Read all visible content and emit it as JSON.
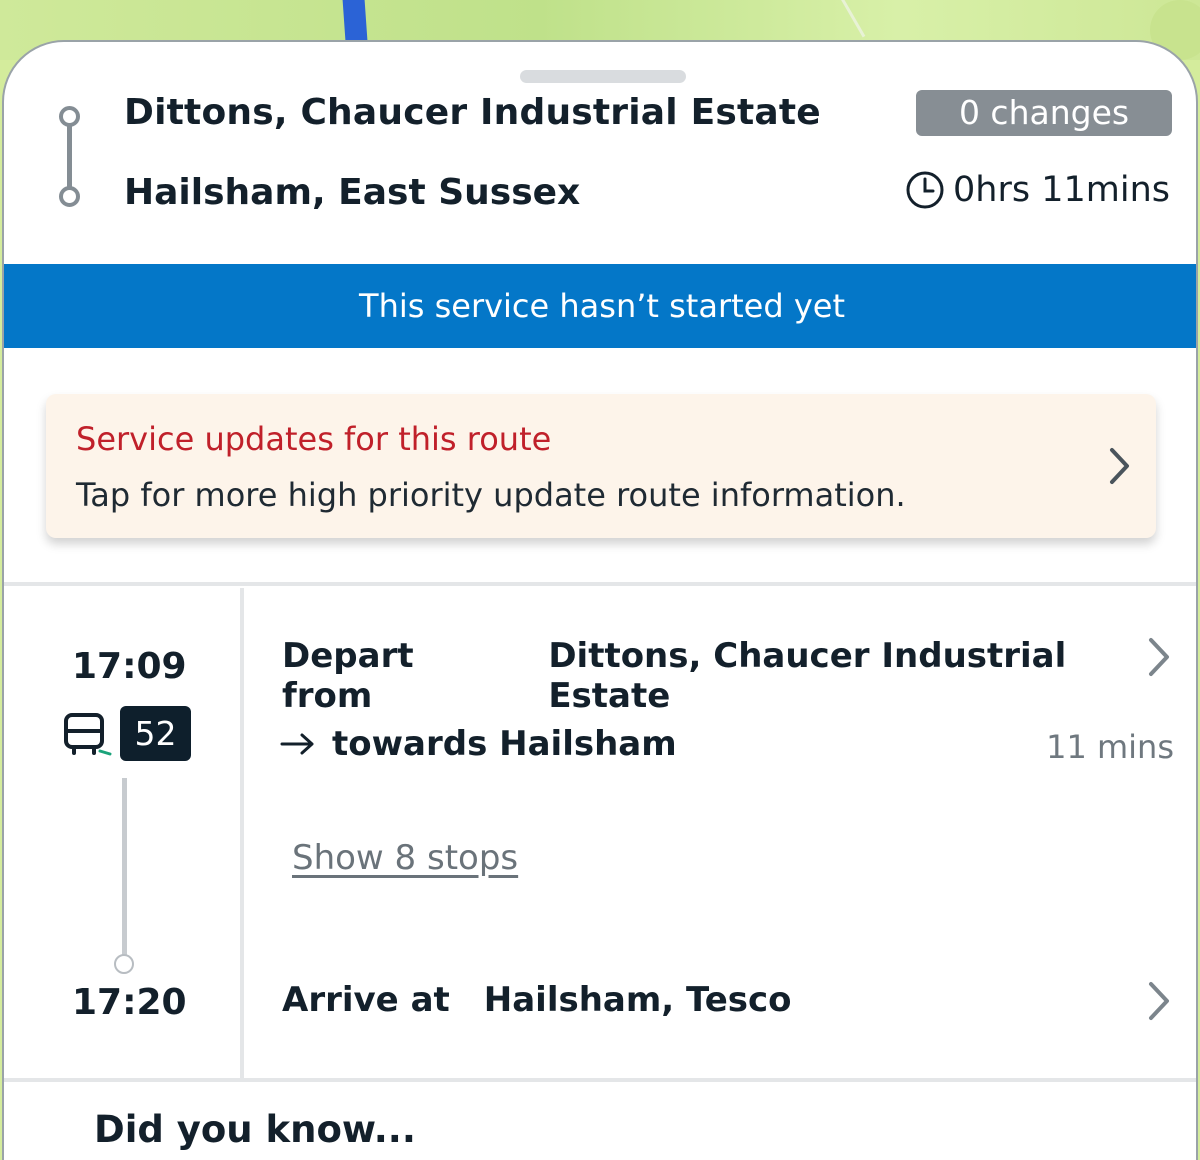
{
  "journey": {
    "origin": "Dittons, Chaucer Industrial Estate",
    "destination": "Hailsham, East Sussex",
    "changes": "0 changes",
    "duration": "0hrs 11mins"
  },
  "status_banner": "This service hasn’t started yet",
  "service_update": {
    "title": "Service updates for this route",
    "description": "Tap for more high priority update route information."
  },
  "leg": {
    "depart_time": "17:09",
    "arrive_time": "17:20",
    "route_number": "52",
    "depart_lead": "Depart from",
    "depart_stop": "Dittons, Chaucer Industrial Estate",
    "towards": "towards Hailsham",
    "leg_duration": "11 mins",
    "show_stops": "Show 8 stops",
    "arrive_lead": "Arrive at",
    "arrive_stop": "Hailsham, Tesco"
  },
  "did_you_know": "Did you know...",
  "colors": {
    "banner": "#0477c8",
    "alert_title": "#c0202a",
    "alert_bg": "#fdf4ea",
    "badge": "#878e94",
    "route_badge": "#0e1f2c"
  },
  "icons": [
    "clock-icon",
    "chevron-right-icon",
    "bus-icon",
    "arrow-right-icon"
  ]
}
